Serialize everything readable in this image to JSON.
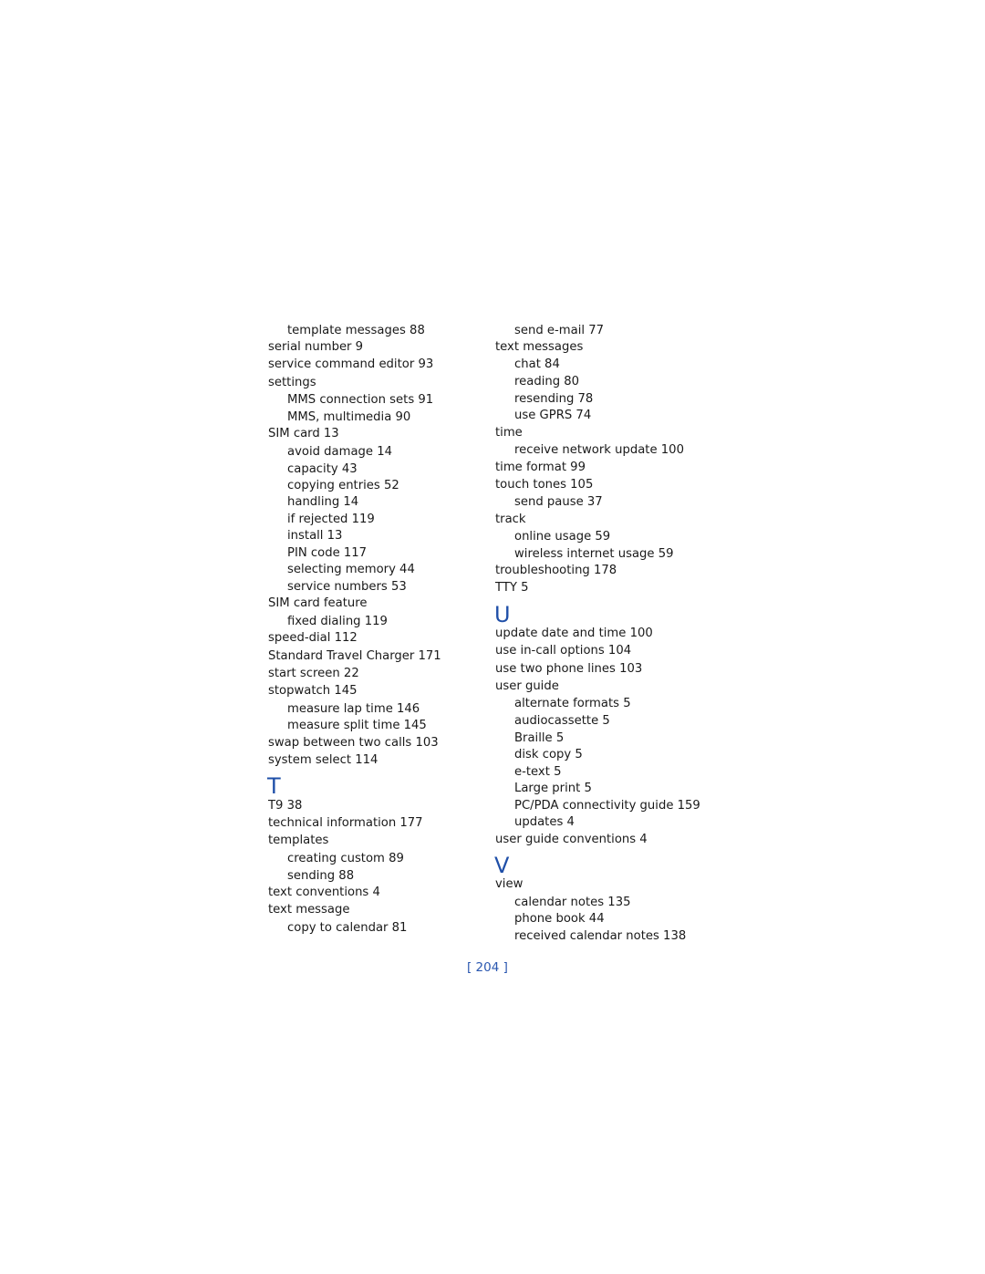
{
  "left_column": {
    "entries": [
      {
        "text": "template messages 88",
        "level": 2
      },
      {
        "text": "serial number 9",
        "level": 1
      },
      {
        "text": "service command editor 93",
        "level": 1
      },
      {
        "text": "settings",
        "level": 1
      },
      {
        "text": "MMS connection sets 91",
        "level": 2
      },
      {
        "text": "MMS, multimedia 90",
        "level": 2
      },
      {
        "text": "SIM card 13",
        "level": 1
      },
      {
        "text": "avoid damage 14",
        "level": 2
      },
      {
        "text": "capacity 43",
        "level": 2
      },
      {
        "text": "copying entries 52",
        "level": 2
      },
      {
        "text": "handling 14",
        "level": 2
      },
      {
        "text": "if rejected 119",
        "level": 2
      },
      {
        "text": "install 13",
        "level": 2
      },
      {
        "text": "PIN code 117",
        "level": 2
      },
      {
        "text": "selecting memory 44",
        "level": 2
      },
      {
        "text": "service numbers 53",
        "level": 2
      },
      {
        "text": "SIM card feature",
        "level": 1
      },
      {
        "text": "fixed dialing 119",
        "level": 2
      },
      {
        "text": "speed-dial 112",
        "level": 1
      },
      {
        "text": "Standard Travel Charger 171",
        "level": 1
      },
      {
        "text": "start screen 22",
        "level": 1
      },
      {
        "text": "stopwatch 145",
        "level": 1
      },
      {
        "text": "measure lap time 146",
        "level": 2
      },
      {
        "text": "measure split time 145",
        "level": 2
      },
      {
        "text": "swap between two calls 103",
        "level": 1
      },
      {
        "text": "system select 114",
        "level": 1
      }
    ],
    "section_t": {
      "letter": "T",
      "entries": [
        {
          "text": "T9 38",
          "level": 1
        },
        {
          "text": "technical information 177",
          "level": 1
        },
        {
          "text": "templates",
          "level": 1
        },
        {
          "text": "creating custom 89",
          "level": 2
        },
        {
          "text": "sending 88",
          "level": 2
        },
        {
          "text": "text conventions 4",
          "level": 1
        },
        {
          "text": "text message",
          "level": 1
        },
        {
          "text": "copy to calendar 81",
          "level": 2
        }
      ]
    }
  },
  "right_column": {
    "entries": [
      {
        "text": "send e-mail 77",
        "level": 2
      },
      {
        "text": "text messages",
        "level": 1
      },
      {
        "text": "chat 84",
        "level": 2
      },
      {
        "text": "reading 80",
        "level": 2
      },
      {
        "text": "resending 78",
        "level": 2
      },
      {
        "text": "use GPRS 74",
        "level": 2
      },
      {
        "text": "time",
        "level": 1
      },
      {
        "text": "receive network update 100",
        "level": 2
      },
      {
        "text": "time format 99",
        "level": 1
      },
      {
        "text": "touch tones 105",
        "level": 1
      },
      {
        "text": "send pause 37",
        "level": 2
      },
      {
        "text": "track",
        "level": 1
      },
      {
        "text": "online usage 59",
        "level": 2
      },
      {
        "text": "wireless internet usage 59",
        "level": 2
      },
      {
        "text": "troubleshooting 178",
        "level": 1
      },
      {
        "text": "TTY 5",
        "level": 1
      }
    ],
    "section_u": {
      "letter": "U",
      "entries": [
        {
          "text": "update date and time 100",
          "level": 1
        },
        {
          "text": "use in-call options 104",
          "level": 1
        },
        {
          "text": "use two phone lines 103",
          "level": 1
        },
        {
          "text": "user guide",
          "level": 1
        },
        {
          "text": "alternate formats 5",
          "level": 2
        },
        {
          "text": "audiocassette 5",
          "level": 2
        },
        {
          "text": "Braille 5",
          "level": 2
        },
        {
          "text": "disk copy 5",
          "level": 2
        },
        {
          "text": "e-text 5",
          "level": 2
        },
        {
          "text": "Large print 5",
          "level": 2
        },
        {
          "text": "PC/PDA connectivity guide 159",
          "level": 2
        },
        {
          "text": "updates 4",
          "level": 2
        },
        {
          "text": "user guide conventions 4",
          "level": 1
        }
      ]
    },
    "section_v": {
      "letter": "V",
      "entries": [
        {
          "text": "view",
          "level": 1
        },
        {
          "text": "calendar notes 135",
          "level": 2
        },
        {
          "text": "phone book 44",
          "level": 2
        },
        {
          "text": "received calendar notes 138",
          "level": 2
        }
      ]
    }
  },
  "footer": {
    "page_number": "[ 204 ]"
  },
  "colors": {
    "text": "#1a1a1a",
    "accent": "#1f4fa8"
  }
}
